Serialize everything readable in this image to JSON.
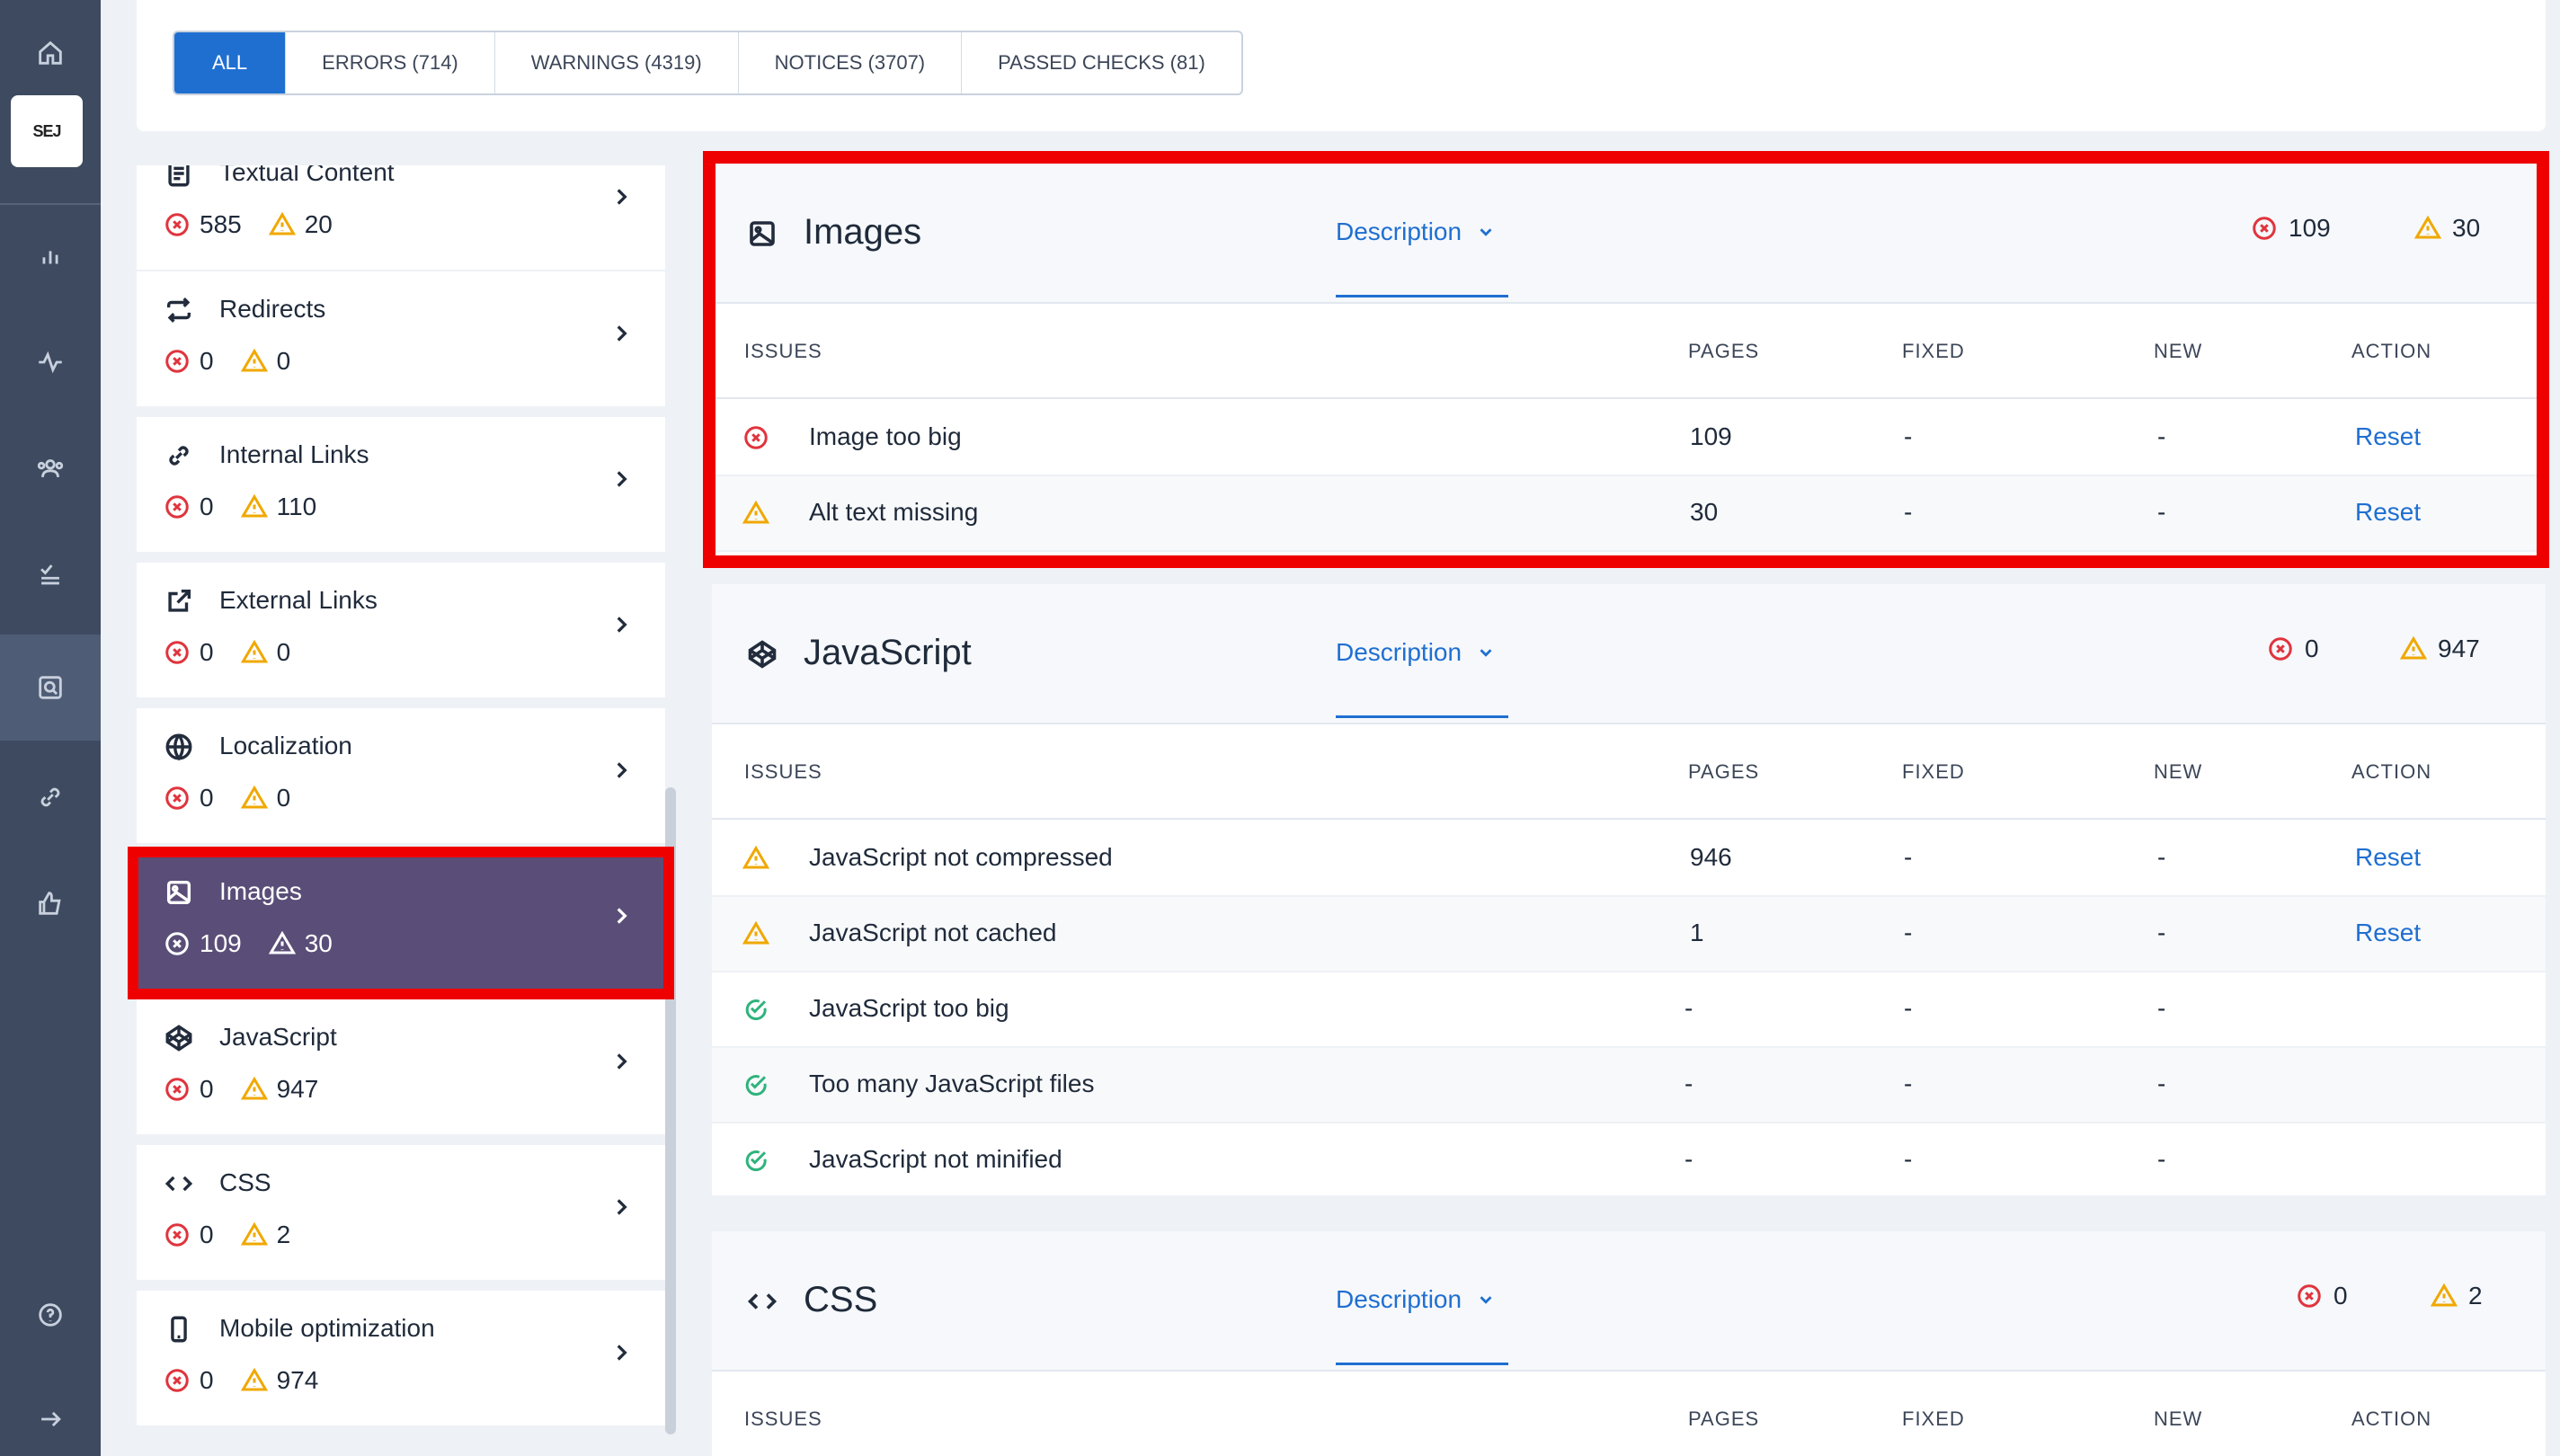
{
  "brand": {
    "logo_text": "SEJ"
  },
  "filters": [
    {
      "label": "ALL",
      "active": true
    },
    {
      "label": "ERRORS (714)",
      "active": false
    },
    {
      "label": "WARNINGS (4319)",
      "active": false
    },
    {
      "label": "NOTICES (3707)",
      "active": false
    },
    {
      "label": "PASSED CHECKS (81)",
      "active": false
    }
  ],
  "categories": [
    {
      "title": "Textual Content",
      "icon": "document-icon",
      "errors": "585",
      "warnings": "20"
    },
    {
      "title": "Redirects",
      "icon": "redirect-icon",
      "errors": "0",
      "warnings": "0"
    },
    {
      "title": "Internal Links",
      "icon": "link-icon",
      "errors": "0",
      "warnings": "110"
    },
    {
      "title": "External Links",
      "icon": "external-link-icon",
      "errors": "0",
      "warnings": "0"
    },
    {
      "title": "Localization",
      "icon": "globe-icon",
      "errors": "0",
      "warnings": "0"
    },
    {
      "title": "Images",
      "icon": "image-icon",
      "errors": "109",
      "warnings": "30",
      "selected": true
    },
    {
      "title": "JavaScript",
      "icon": "codepen-icon",
      "errors": "0",
      "warnings": "947"
    },
    {
      "title": "CSS",
      "icon": "code-icon",
      "errors": "0",
      "warnings": "2"
    },
    {
      "title": "Mobile optimization",
      "icon": "mobile-icon",
      "errors": "0",
      "warnings": "974"
    }
  ],
  "table_headers": {
    "issues": "ISSUES",
    "pages": "PAGES",
    "fixed": "FIXED",
    "new": "NEW",
    "action": "ACTION"
  },
  "panels": [
    {
      "title": "Images",
      "description_label": "Description",
      "errors": "109",
      "warnings": "30",
      "rows": [
        {
          "status": "error",
          "issue": "Image too big",
          "pages": "109",
          "fixed": "-",
          "new": "-",
          "action": "Reset"
        },
        {
          "status": "warning",
          "issue": "Alt text missing",
          "pages": "30",
          "fixed": "-",
          "new": "-",
          "action": "Reset"
        }
      ]
    },
    {
      "title": "JavaScript",
      "description_label": "Description",
      "errors": "0",
      "warnings": "947",
      "rows": [
        {
          "status": "warning",
          "issue": "JavaScript not compressed",
          "pages": "946",
          "fixed": "-",
          "new": "-",
          "action": "Reset"
        },
        {
          "status": "warning",
          "issue": "JavaScript not cached",
          "pages": "1",
          "fixed": "-",
          "new": "-",
          "action": "Reset"
        },
        {
          "status": "passed",
          "issue": "JavaScript too big",
          "pages": "-",
          "fixed": "-",
          "new": "-",
          "action": ""
        },
        {
          "status": "passed",
          "issue": "Too many JavaScript files",
          "pages": "-",
          "fixed": "-",
          "new": "-",
          "action": ""
        },
        {
          "status": "passed",
          "issue": "JavaScript not minified",
          "pages": "-",
          "fixed": "-",
          "new": "-",
          "action": ""
        }
      ]
    },
    {
      "title": "CSS",
      "description_label": "Description",
      "errors": "0",
      "warnings": "2",
      "rows": []
    }
  ],
  "colors": {
    "accent": "#1f6fd1",
    "error": "#e0343d",
    "warning": "#f0a800",
    "passed": "#2eb37c",
    "selected": "#5a4e78",
    "highlight": "#ee0000",
    "rail": "#3d4a60"
  }
}
